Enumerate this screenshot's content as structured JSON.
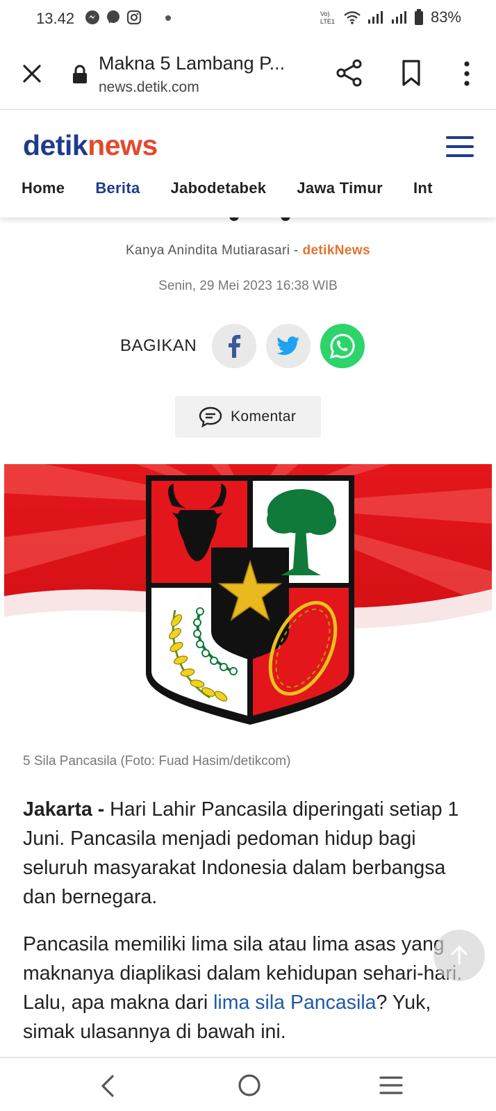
{
  "status_bar": {
    "time": "13.42",
    "battery": "83%",
    "left_icons": [
      "messenger-icon",
      "chat-icon",
      "instagram-icon",
      "dot-icon"
    ],
    "right_icons": [
      "volte-icon",
      "wifi-icon",
      "signal-icon",
      "signal-icon",
      "battery-icon"
    ]
  },
  "browser": {
    "page_title": "Makna 5 Lambang P...",
    "url": "news.detik.com",
    "icons": [
      "close-icon",
      "lock-icon",
      "share-icon",
      "bookmark-icon",
      "more-icon"
    ]
  },
  "site": {
    "logo_part1": "detik",
    "logo_part2": "news",
    "nav": [
      {
        "label": "Home",
        "active": false
      },
      {
        "label": "Berita",
        "active": true
      },
      {
        "label": "Jabodetabek",
        "active": false
      },
      {
        "label": "Jawa Timur",
        "active": false
      },
      {
        "label": "Int",
        "active": false
      }
    ],
    "brand_color": "#1f3b8c",
    "accent_color": "#e3492c"
  },
  "article": {
    "author": "Kanya Anindita Mutiarasari",
    "separator": " - ",
    "source": "detikNews",
    "date": "Senin, 29 Mei 2023 16:38 WIB",
    "share_label": "BAGIKAN",
    "share_buttons": [
      "facebook-icon",
      "twitter-icon",
      "whatsapp-icon"
    ],
    "comment_label": "Komentar",
    "image_caption": "5 Sila Pancasila (Foto: Fuad Hasim/detikcom)",
    "p1_location": "Jakarta",
    "p1_dash": " - ",
    "p1_text": "Hari Lahir Pancasila diperingati setiap 1 Juni. Pancasila menjadi pedoman hidup bagi seluruh masyarakat Indonesia dalam berbangsa dan bernegara.",
    "p2_before_link": "Pancasila memiliki lima sila atau lima asas yang maknanya diaplikasi dalam kehidupan sehari-hari. Lalu, apa makna dari ",
    "p2_link": "lima sila Pancasila",
    "p2_after_link": "? Yuk, simak ulasannya di bawah ini."
  },
  "system_nav": {
    "icons": [
      "back-icon",
      "home-icon",
      "recent-apps-icon"
    ]
  }
}
